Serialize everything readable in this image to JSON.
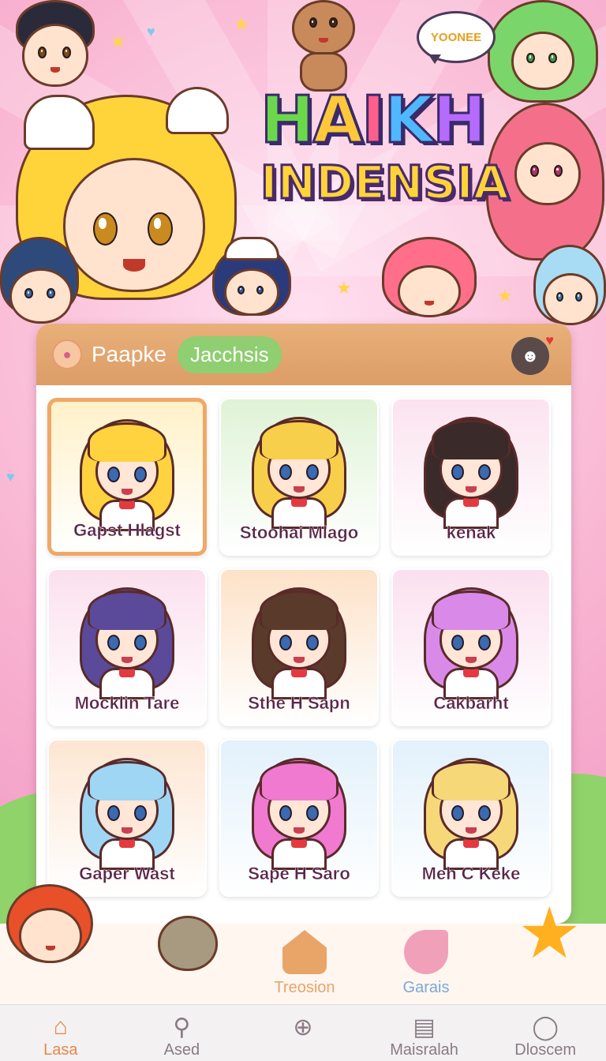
{
  "title": {
    "line1": "HAIKH",
    "line2": "INDENSIA"
  },
  "speech_bubble": "YOONEE",
  "header": {
    "brand": "Paapke",
    "active_tab": "Jacchsis"
  },
  "cards": [
    {
      "name": "Gapst Hlagst",
      "bg": "#fff1c9",
      "hair": "#ffd23f",
      "selected": true
    },
    {
      "name": "Stoohai Mlago",
      "bg": "#dff3d6",
      "hair": "#f7cf4a",
      "selected": false
    },
    {
      "name": "kenak",
      "bg": "#fbe3ef",
      "hair": "#3a2a2a",
      "selected": false
    },
    {
      "name": "Mocklin Tare",
      "bg": "#fbe0ee",
      "hair": "#5b4a9a",
      "selected": false
    },
    {
      "name": "Sthe H Sapn",
      "bg": "#fde2c8",
      "hair": "#5a3a2a",
      "selected": false
    },
    {
      "name": "Cakbarht",
      "bg": "#fbe0ef",
      "hair": "#d98ae8",
      "selected": false
    },
    {
      "name": "Gaper Wast",
      "bg": "#fde6d2",
      "hair": "#9fd6f4",
      "selected": false
    },
    {
      "name": "Sape H Saro",
      "bg": "#e2f1fb",
      "hair": "#f07ad0",
      "selected": false
    },
    {
      "name": "Meh C Keke",
      "bg": "#e2f1fb",
      "hair": "#f6d878",
      "selected": false
    }
  ],
  "subnav": [
    {
      "label": "Treosion",
      "color": "#e9a468"
    },
    {
      "label": "Garais",
      "color": "#7aa8d8"
    }
  ],
  "tabbar": [
    {
      "label": "Lasa",
      "icon": "home-icon",
      "glyph": "⌂"
    },
    {
      "label": "Ased",
      "icon": "search-icon",
      "glyph": "⚲"
    },
    {
      "label": "",
      "icon": "add-icon",
      "glyph": "⊕"
    },
    {
      "label": "Maisralah",
      "icon": "calendar-icon",
      "glyph": "▤"
    },
    {
      "label": "Dloscem",
      "icon": "profile-icon",
      "glyph": "◯"
    }
  ]
}
